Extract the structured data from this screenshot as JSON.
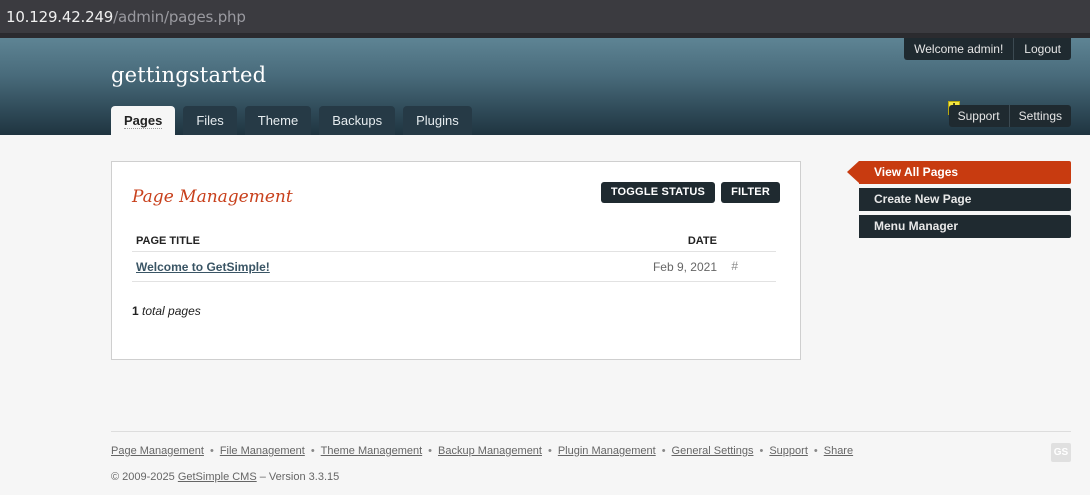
{
  "browser": {
    "url_host": "10.129.42.249",
    "url_path": "/admin/pages.php"
  },
  "header": {
    "site_title": "gettingstarted",
    "welcome": "Welcome admin!",
    "logout": "Logout",
    "tabs": [
      {
        "label": "Pages",
        "active": true
      },
      {
        "label": "Files"
      },
      {
        "label": "Theme"
      },
      {
        "label": "Backups"
      },
      {
        "label": "Plugins"
      }
    ],
    "warning_icon": "!",
    "support": "Support",
    "settings": "Settings"
  },
  "panel": {
    "title": "Page Management",
    "toggle_status": "TOGGLE STATUS",
    "filter": "FILTER",
    "columns": {
      "title": "PAGE TITLE",
      "date": "DATE"
    },
    "rows": [
      {
        "title": "Welcome to GetSimple!",
        "date": "Feb 9, 2021",
        "link": "#"
      }
    ],
    "total_count": "1",
    "total_label": "total pages"
  },
  "sidebar": {
    "items": [
      {
        "label": "View All Pages",
        "active": true
      },
      {
        "label": "Create New Page"
      },
      {
        "label": "Menu Manager"
      }
    ]
  },
  "footer": {
    "links": [
      "Page Management",
      "File Management",
      "Theme Management",
      "Backup Management",
      "Plugin Management",
      "General Settings",
      "Support",
      "Share"
    ],
    "separator": "•",
    "copyright_prefix": "© 2009-2025",
    "cms_link": "GetSimple CMS",
    "version": "– Version 3.3.15",
    "logo_text": "GS"
  },
  "colors": {
    "accent": "#c83b10",
    "dark": "#1f2a30",
    "link": "#3a5565"
  }
}
